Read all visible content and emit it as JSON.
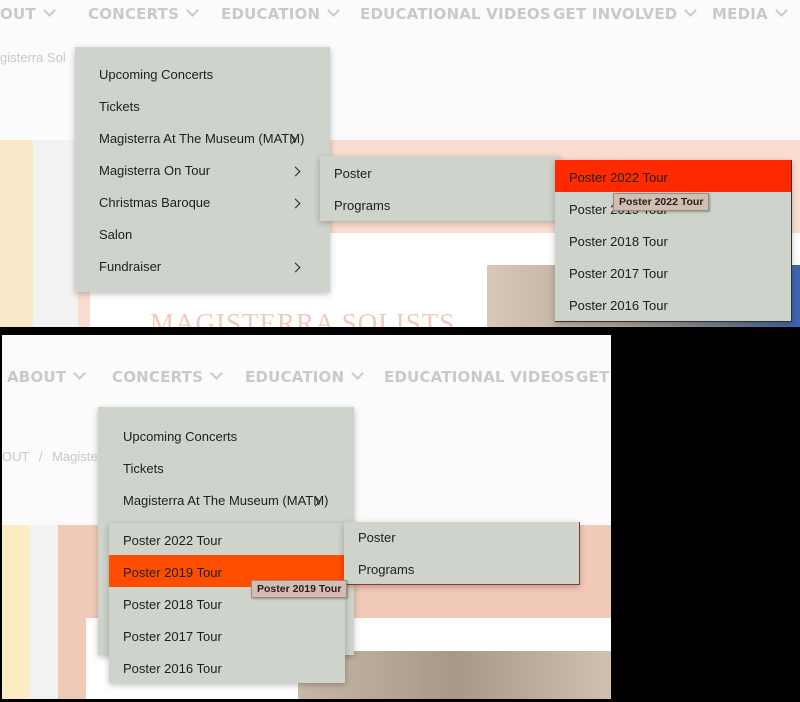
{
  "top": {
    "nav": [
      {
        "label": "OUT"
      },
      {
        "label": "CONCERTS"
      },
      {
        "label": "EDUCATION"
      },
      {
        "label": "EDUCATIONAL VIDEOS"
      },
      {
        "label": "GET INVOLVED"
      },
      {
        "label": "MEDIA"
      }
    ],
    "breadcrumb_fragment": "gisterra Sol",
    "banner_fragment": "MAGISTERRA SOLISTS",
    "menu": {
      "items": [
        "Upcoming Concerts",
        "Tickets",
        "Magisterra At The Museum (MATM)",
        "Magisterra On Tour",
        "Christmas Baroque",
        "Salon",
        "Fundraiser"
      ],
      "submenu": [
        "Poster",
        "Programs"
      ],
      "posters": [
        "Poster 2022 Tour",
        "Poster 2019 Tour",
        "Poster 2018 Tour",
        "Poster 2017 Tour",
        "Poster 2016 Tour"
      ]
    },
    "tooltip": "Poster 2022 Tour",
    "highlight_color": "#ff2a00"
  },
  "bottom": {
    "nav": [
      {
        "label": "ABOUT"
      },
      {
        "label": "CONCERTS"
      },
      {
        "label": "EDUCATION"
      },
      {
        "label": "EDUCATIONAL VIDEOS"
      },
      {
        "label": "GET I"
      }
    ],
    "breadcrumb": {
      "part1": "OUT",
      "sep": "/",
      "part2": "Magiste"
    },
    "menu": {
      "items": [
        "Upcoming Concerts",
        "Tickets",
        "Magisterra At The Museum (MATM)"
      ],
      "posters": [
        "Poster 2022 Tour",
        "Poster 2019 Tour",
        "Poster 2018 Tour",
        "Poster 2017 Tour",
        "Poster 2016 Tour"
      ],
      "submenu": [
        "Poster",
        "Programs"
      ]
    },
    "tooltip": "Poster 2019 Tour",
    "highlight_color": "#ff4d00"
  }
}
